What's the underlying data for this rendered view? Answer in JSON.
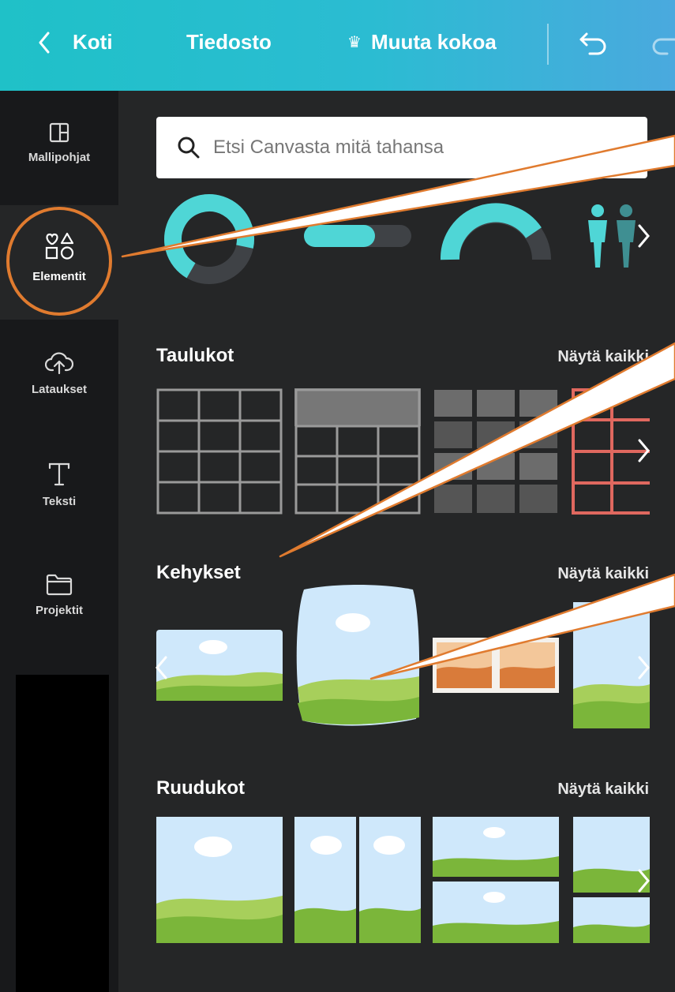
{
  "topbar": {
    "home_label": "Koti",
    "file_label": "Tiedosto",
    "resize_label": "Muuta kokoa",
    "crown_glyph": "♛"
  },
  "sidebar": {
    "items": [
      {
        "label": "Mallipohjat",
        "icon": "layout-icon"
      },
      {
        "label": "Elementit",
        "icon": "shapes-icon"
      },
      {
        "label": "Lataukset",
        "icon": "cloud-upload-icon"
      },
      {
        "label": "Teksti",
        "icon": "text-icon"
      },
      {
        "label": "Projektit",
        "icon": "folder-icon"
      }
    ]
  },
  "search": {
    "placeholder": "Etsi Canvasta mitä tahansa"
  },
  "sections": {
    "tables": {
      "title": "Taulukot",
      "see_all": "Näytä kaikki"
    },
    "frames": {
      "title": "Kehykset",
      "see_all": "Näytä kaikki"
    },
    "grids": {
      "title": "Ruudukot",
      "see_all": "Näytä kaikki"
    }
  },
  "colors": {
    "accent_teal": "#4fd6d6",
    "topbar": "#22bfcc",
    "panel_bg": "#252627",
    "sidebar_bg": "#18191b",
    "annotation": "#e07b2f",
    "sky": "#cfe8fb",
    "grass": "#7bb63a"
  },
  "progress_widgets": {
    "ring_fraction": 0.7,
    "bar_fraction": 0.66,
    "gauge_fraction": 0.8
  }
}
